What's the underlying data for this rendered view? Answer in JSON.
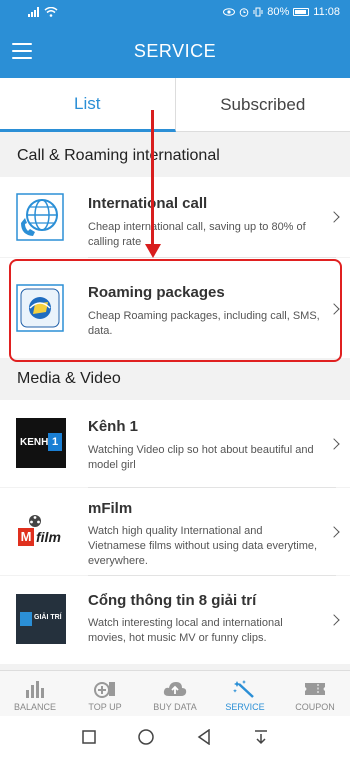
{
  "status": {
    "percent": "80%",
    "time": "11:08"
  },
  "header": {
    "title": "SERVICE"
  },
  "tabs": [
    {
      "label": "List"
    },
    {
      "label": "Subscribed"
    }
  ],
  "sections": {
    "call_roaming": "Call & Roaming international",
    "media_video": "Media & Video"
  },
  "items": {
    "international_call": {
      "title": "International call",
      "desc": "Cheap international call, saving up to 80% of calling rate"
    },
    "roaming": {
      "title": "Roaming packages",
      "desc": "Cheap Roaming packages, including call, SMS, data."
    },
    "kenh1": {
      "title": "Kênh 1",
      "desc": "Watching Video clip so hot about beautiful and model girl",
      "logo_text": "KENH",
      "logo_num": "1"
    },
    "mfilm": {
      "title": "mFilm",
      "desc": "Watch high quality International and Vietnamese films without using data everytime, everywhere.",
      "logo_m": "M",
      "logo_text": "film"
    },
    "giaitri": {
      "title": "Cổng thông tin 8 giải trí",
      "desc": "Watch interesting local and international movies, hot music MV or funny clips.",
      "logo_text": "GIẢI TRÍ"
    }
  },
  "bottom_nav": [
    {
      "label": "BALANCE",
      "icon": "bar-chart-icon"
    },
    {
      "label": "TOP UP",
      "icon": "topup-icon"
    },
    {
      "label": "BUY DATA",
      "icon": "cloud-upload-icon"
    },
    {
      "label": "SERVICE",
      "icon": "magic-wand-icon"
    },
    {
      "label": "COUPON",
      "icon": "ticket-icon"
    }
  ],
  "colors": {
    "accent": "#2b8fd6",
    "highlight": "#e02020"
  }
}
